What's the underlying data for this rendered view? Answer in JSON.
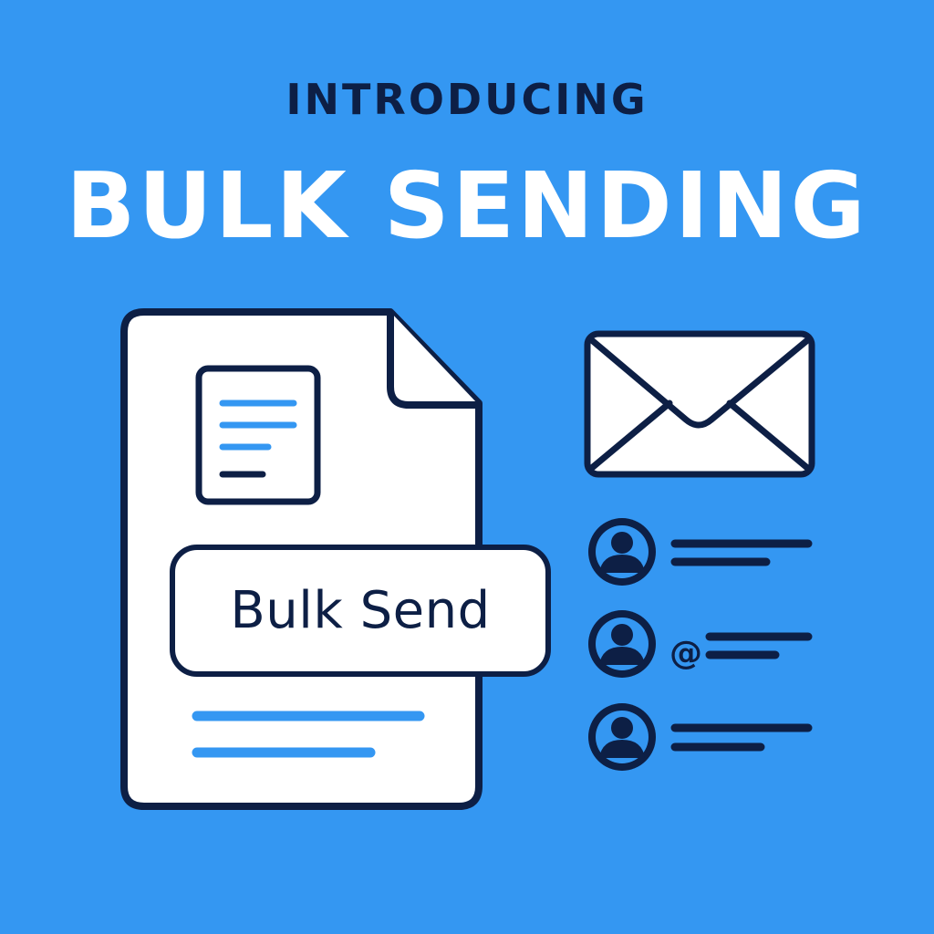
{
  "eyebrow": "INTRODUCING",
  "headline": "BULK SENDING",
  "button": {
    "label": "Bulk Send"
  },
  "recipients": [
    {
      "icon": "user-avatar-icon",
      "has_at_symbol": false
    },
    {
      "icon": "user-avatar-icon",
      "has_at_symbol": true,
      "at_symbol": "@"
    },
    {
      "icon": "user-avatar-icon",
      "has_at_symbol": false
    }
  ],
  "icons": [
    "document-icon",
    "envelope-icon",
    "user-avatar-icon"
  ],
  "colors": {
    "background": "#3497f2",
    "navy": "#0d1f45",
    "accent": "#3497f2",
    "white": "#ffffff"
  }
}
